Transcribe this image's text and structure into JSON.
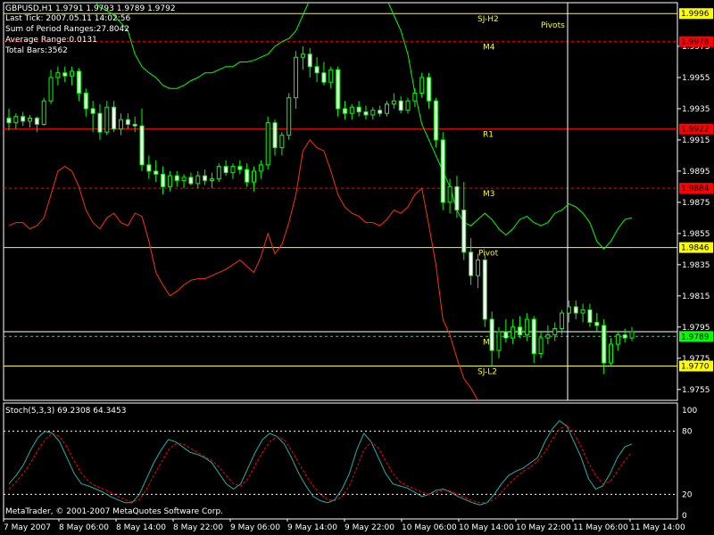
{
  "header": {
    "symbol_line": "GBPUSD,H1  1.9791 1.9793 1.9789 1.9792",
    "last_tick": "Last Tick: 2007.05.11 14:02:56",
    "sum_ranges": "Sum of Period Ranges:27.8042",
    "avg_range": "Average Range:0.0131",
    "total_bars": "Total Bars:3562"
  },
  "footer": {
    "copyright": "MetaTrader, © 2001-2007 MetaQuotes Software Corp.",
    "stoch_title": "Stoch(5,3,3) 69.2308 64.3453"
  },
  "colors": {
    "background": "#000000",
    "candle": "#00ff00",
    "upper_band": "#00ff00",
    "lower_band": "#ff3300",
    "pivot_line": "#ffff00",
    "resistance_line": "#ff0000",
    "stoch_main": "#20b2aa",
    "stoch_signal": "#ff0000",
    "axis": "#ffffff",
    "price_label_bg": "#000000"
  },
  "chart_data": [
    {
      "type": "candlestick",
      "title": "GBPUSD,H1",
      "ylim": [
        1.9748,
        2.0003
      ],
      "y_ticks": [
        1.9975,
        1.9955,
        1.9935,
        1.9915,
        1.9895,
        1.9875,
        1.9855,
        1.9835,
        1.9815,
        1.9795,
        1.9775,
        1.9755
      ],
      "x_ticks": [
        "7 May 2007",
        "8 May 06:00",
        "8 May 14:00",
        "8 May 22:00",
        "9 May 06:00",
        "9 May 14:00",
        "9 May 22:00",
        "10 May 06:00",
        "10 May 14:00",
        "10 May 22:00",
        "11 May 06:00",
        "11 May 14:00"
      ],
      "current_price": 1.9789,
      "levels": [
        {
          "name": "SJ-H2",
          "value": 1.9996,
          "color": "#ffff00"
        },
        {
          "name": "M4",
          "value": 1.9978,
          "color": "#ff0000",
          "dashed": true
        },
        {
          "name": "R1",
          "value": 1.9922,
          "color": "#ff0000"
        },
        {
          "name": "M3",
          "value": 1.9884,
          "color": "#ff0000",
          "dashed": true
        },
        {
          "name": "Pivot",
          "value": 1.9846,
          "color": "#ffff00"
        },
        {
          "name": "M2",
          "value": 1.9789,
          "color": "#00ff00",
          "dashed": true
        },
        {
          "name": "",
          "value": 1.9792,
          "color": "#ffffff"
        },
        {
          "name": "SJ-L2",
          "value": 1.977,
          "color": "#ffff00"
        }
      ],
      "price_labels": [
        {
          "text": "1.9996",
          "value": 1.9996,
          "bg": "#ffff00",
          "fg": "#000000"
        },
        {
          "text": "1.9978",
          "value": 1.9978,
          "bg": "#ff0000",
          "fg": "#000000"
        },
        {
          "text": "1.9922",
          "value": 1.9922,
          "bg": "#ff0000",
          "fg": "#000000"
        },
        {
          "text": "1.9884",
          "value": 1.9884,
          "bg": "#ff0000",
          "fg": "#000000"
        },
        {
          "text": "1.9846",
          "value": 1.9846,
          "bg": "#ffff00",
          "fg": "#000000"
        },
        {
          "text": "1.9789",
          "value": 1.9789,
          "bg": "#00ff00",
          "fg": "#000000"
        },
        {
          "text": "1.9770",
          "value": 1.977,
          "bg": "#ffff00",
          "fg": "#000000"
        }
      ],
      "vertical_marker_label": "Pivots",
      "candles": [
        {
          "o": 1.9929,
          "h": 1.9935,
          "l": 1.9921,
          "c": 1.9926
        },
        {
          "o": 1.9926,
          "h": 1.9932,
          "l": 1.9922,
          "c": 1.993
        },
        {
          "o": 1.993,
          "h": 1.9933,
          "l": 1.9924,
          "c": 1.9927
        },
        {
          "o": 1.9927,
          "h": 1.9931,
          "l": 1.9923,
          "c": 1.9929
        },
        {
          "o": 1.9929,
          "h": 1.993,
          "l": 1.992,
          "c": 1.9925
        },
        {
          "o": 1.9925,
          "h": 1.9942,
          "l": 1.9924,
          "c": 1.994
        },
        {
          "o": 1.994,
          "h": 1.996,
          "l": 1.9938,
          "c": 1.9955
        },
        {
          "o": 1.9955,
          "h": 1.9962,
          "l": 1.995,
          "c": 1.9958
        },
        {
          "o": 1.9958,
          "h": 1.9962,
          "l": 1.9952,
          "c": 1.9956
        },
        {
          "o": 1.9956,
          "h": 1.9962,
          "l": 1.995,
          "c": 1.9959
        },
        {
          "o": 1.9959,
          "h": 1.9961,
          "l": 1.994,
          "c": 1.9945
        },
        {
          "o": 1.9945,
          "h": 1.9948,
          "l": 1.993,
          "c": 1.9935
        },
        {
          "o": 1.9935,
          "h": 1.994,
          "l": 1.992,
          "c": 1.9932
        },
        {
          "o": 1.9932,
          "h": 1.9938,
          "l": 1.9915,
          "c": 1.992
        },
        {
          "o": 1.992,
          "h": 1.994,
          "l": 1.9918,
          "c": 1.9936
        },
        {
          "o": 1.9936,
          "h": 1.994,
          "l": 1.992,
          "c": 1.9922
        },
        {
          "o": 1.9922,
          "h": 1.9932,
          "l": 1.9918,
          "c": 1.9928
        },
        {
          "o": 1.9928,
          "h": 1.9932,
          "l": 1.9922,
          "c": 1.9925
        },
        {
          "o": 1.9925,
          "h": 1.993,
          "l": 1.992,
          "c": 1.9924
        },
        {
          "o": 1.9924,
          "h": 1.9935,
          "l": 1.9895,
          "c": 1.9899
        },
        {
          "o": 1.9899,
          "h": 1.9905,
          "l": 1.989,
          "c": 1.9895
        },
        {
          "o": 1.9895,
          "h": 1.9902,
          "l": 1.9888,
          "c": 1.9893
        },
        {
          "o": 1.9893,
          "h": 1.9898,
          "l": 1.988,
          "c": 1.9885
        },
        {
          "o": 1.9885,
          "h": 1.9895,
          "l": 1.9882,
          "c": 1.9892
        },
        {
          "o": 1.9892,
          "h": 1.9895,
          "l": 1.9885,
          "c": 1.9889
        },
        {
          "o": 1.9889,
          "h": 1.9893,
          "l": 1.9884,
          "c": 1.9891
        },
        {
          "o": 1.9891,
          "h": 1.9894,
          "l": 1.9886,
          "c": 1.9887
        },
        {
          "o": 1.9887,
          "h": 1.9895,
          "l": 1.9884,
          "c": 1.9892
        },
        {
          "o": 1.9892,
          "h": 1.9896,
          "l": 1.9886,
          "c": 1.9889
        },
        {
          "o": 1.9889,
          "h": 1.9894,
          "l": 1.9884,
          "c": 1.989
        },
        {
          "o": 1.989,
          "h": 1.99,
          "l": 1.9888,
          "c": 1.9898
        },
        {
          "o": 1.9898,
          "h": 1.9902,
          "l": 1.9892,
          "c": 1.9894
        },
        {
          "o": 1.9894,
          "h": 1.99,
          "l": 1.989,
          "c": 1.9898
        },
        {
          "o": 1.9898,
          "h": 1.9902,
          "l": 1.9893,
          "c": 1.9896
        },
        {
          "o": 1.9896,
          "h": 1.99,
          "l": 1.9885,
          "c": 1.9888
        },
        {
          "o": 1.9888,
          "h": 1.9898,
          "l": 1.9882,
          "c": 1.9895
        },
        {
          "o": 1.9895,
          "h": 1.9902,
          "l": 1.989,
          "c": 1.9899
        },
        {
          "o": 1.9899,
          "h": 1.993,
          "l": 1.9896,
          "c": 1.9926
        },
        {
          "o": 1.9926,
          "h": 1.9928,
          "l": 1.9905,
          "c": 1.991
        },
        {
          "o": 1.991,
          "h": 1.992,
          "l": 1.9905,
          "c": 1.9918
        },
        {
          "o": 1.9918,
          "h": 1.9945,
          "l": 1.9915,
          "c": 1.9942
        },
        {
          "o": 1.9942,
          "h": 1.9972,
          "l": 1.9935,
          "c": 1.9968
        },
        {
          "o": 1.9968,
          "h": 1.9975,
          "l": 1.996,
          "c": 1.997
        },
        {
          "o": 1.997,
          "h": 1.9974,
          "l": 1.9955,
          "c": 1.9962
        },
        {
          "o": 1.9962,
          "h": 1.9968,
          "l": 1.9952,
          "c": 1.9958
        },
        {
          "o": 1.9958,
          "h": 1.9965,
          "l": 1.995,
          "c": 1.9952
        },
        {
          "o": 1.9952,
          "h": 1.9962,
          "l": 1.9948,
          "c": 1.996
        },
        {
          "o": 1.996,
          "h": 1.9962,
          "l": 1.993,
          "c": 1.9935
        },
        {
          "o": 1.9935,
          "h": 1.994,
          "l": 1.9928,
          "c": 1.9932
        },
        {
          "o": 1.9932,
          "h": 1.9938,
          "l": 1.9928,
          "c": 1.9936
        },
        {
          "o": 1.9936,
          "h": 1.994,
          "l": 1.993,
          "c": 1.9933
        },
        {
          "o": 1.9933,
          "h": 1.9937,
          "l": 1.9928,
          "c": 1.9931
        },
        {
          "o": 1.9931,
          "h": 1.9936,
          "l": 1.9928,
          "c": 1.9934
        },
        {
          "o": 1.9934,
          "h": 1.9937,
          "l": 1.993,
          "c": 1.9932
        },
        {
          "o": 1.9932,
          "h": 1.994,
          "l": 1.993,
          "c": 1.9938
        },
        {
          "o": 1.9938,
          "h": 1.9945,
          "l": 1.9935,
          "c": 1.994
        },
        {
          "o": 1.994,
          "h": 1.9943,
          "l": 1.9932,
          "c": 1.9934
        },
        {
          "o": 1.9934,
          "h": 1.9942,
          "l": 1.9932,
          "c": 1.994
        },
        {
          "o": 1.994,
          "h": 1.9948,
          "l": 1.9936,
          "c": 1.9945
        },
        {
          "o": 1.9945,
          "h": 1.9958,
          "l": 1.9942,
          "c": 1.9955
        },
        {
          "o": 1.9955,
          "h": 1.9958,
          "l": 1.9935,
          "c": 1.994
        },
        {
          "o": 1.994,
          "h": 1.9942,
          "l": 1.991,
          "c": 1.9915
        },
        {
          "o": 1.9915,
          "h": 1.992,
          "l": 1.987,
          "c": 1.9875
        },
        {
          "o": 1.9875,
          "h": 1.989,
          "l": 1.9868,
          "c": 1.9885
        },
        {
          "o": 1.9885,
          "h": 1.9892,
          "l": 1.9865,
          "c": 1.987
        },
        {
          "o": 1.987,
          "h": 1.9888,
          "l": 1.9838,
          "c": 1.9843
        },
        {
          "o": 1.9843,
          "h": 1.9852,
          "l": 1.9822,
          "c": 1.9828
        },
        {
          "o": 1.9828,
          "h": 1.9842,
          "l": 1.982,
          "c": 1.9838
        },
        {
          "o": 1.9838,
          "h": 1.9842,
          "l": 1.9795,
          "c": 1.98
        },
        {
          "o": 1.98,
          "h": 1.9805,
          "l": 1.977,
          "c": 1.978
        },
        {
          "o": 1.978,
          "h": 1.9795,
          "l": 1.9775,
          "c": 1.9792
        },
        {
          "o": 1.9792,
          "h": 1.98,
          "l": 1.9785,
          "c": 1.9788
        },
        {
          "o": 1.9788,
          "h": 1.98,
          "l": 1.9784,
          "c": 1.9795
        },
        {
          "o": 1.9795,
          "h": 1.9802,
          "l": 1.9788,
          "c": 1.979
        },
        {
          "o": 1.979,
          "h": 1.9804,
          "l": 1.9786,
          "c": 1.98
        },
        {
          "o": 1.98,
          "h": 1.9802,
          "l": 1.9772,
          "c": 1.9778
        },
        {
          "o": 1.9778,
          "h": 1.9792,
          "l": 1.9775,
          "c": 1.9788
        },
        {
          "o": 1.9788,
          "h": 1.9796,
          "l": 1.9784,
          "c": 1.979
        },
        {
          "o": 1.979,
          "h": 1.9798,
          "l": 1.9786,
          "c": 1.9794
        },
        {
          "o": 1.9794,
          "h": 1.9806,
          "l": 1.979,
          "c": 1.9804
        },
        {
          "o": 1.9804,
          "h": 1.9812,
          "l": 1.9798,
          "c": 1.9808
        },
        {
          "o": 1.9808,
          "h": 1.9812,
          "l": 1.98,
          "c": 1.9804
        },
        {
          "o": 1.9804,
          "h": 1.981,
          "l": 1.9798,
          "c": 1.9806
        },
        {
          "o": 1.9806,
          "h": 1.981,
          "l": 1.9795,
          "c": 1.9798
        },
        {
          "o": 1.9798,
          "h": 1.9804,
          "l": 1.9792,
          "c": 1.9796
        },
        {
          "o": 1.9796,
          "h": 1.98,
          "l": 1.9765,
          "c": 1.9772
        },
        {
          "o": 1.9772,
          "h": 1.9788,
          "l": 1.977,
          "c": 1.9784
        },
        {
          "o": 1.9784,
          "h": 1.9792,
          "l": 1.978,
          "c": 1.979
        },
        {
          "o": 1.979,
          "h": 1.9794,
          "l": 1.9785,
          "c": 1.9788
        },
        {
          "o": 1.9788,
          "h": 1.9795,
          "l": 1.9786,
          "c": 1.9792
        }
      ],
      "upper_band": [
        2.0015,
        2.0015,
        2.0015,
        2.0015,
        2.0015,
        2.0015,
        2.0015,
        2.0015,
        2.0015,
        2.0015,
        2.0012,
        2.0008,
        2.0005,
        2.0,
        1.9998,
        1.9995,
        1.999,
        1.9985,
        1.997,
        1.9962,
        1.9958,
        1.9955,
        1.995,
        1.9948,
        1.9948,
        1.995,
        1.9953,
        1.9955,
        1.9958,
        1.9958,
        1.996,
        1.9962,
        1.9962,
        1.9965,
        1.9965,
        1.9966,
        1.9968,
        1.997,
        1.9975,
        1.9978,
        1.998,
        1.9985,
        1.9995,
        2.0005,
        2.0012,
        2.0015,
        2.0015,
        2.0015,
        2.0015,
        2.0015,
        2.0015,
        2.0015,
        2.0015,
        2.0015,
        2.0005,
        1.9995,
        1.9985,
        1.997,
        1.9945,
        1.9925,
        1.9915,
        1.9905,
        1.9895,
        1.9885,
        1.987,
        1.9862,
        1.986,
        1.9864,
        1.9868,
        1.9864,
        1.9858,
        1.9854,
        1.9858,
        1.9864,
        1.9866,
        1.9862,
        1.986,
        1.9862,
        1.9868,
        1.987,
        1.9874,
        1.9872,
        1.9868,
        1.9862,
        1.985,
        1.9845,
        1.985,
        1.9858,
        1.9864,
        1.9865
      ],
      "lower_band": [
        1.986,
        1.9862,
        1.9862,
        1.9858,
        1.986,
        1.9865,
        1.988,
        1.9895,
        1.9898,
        1.9895,
        1.9885,
        1.987,
        1.9862,
        1.9858,
        1.9865,
        1.9868,
        1.9862,
        1.986,
        1.9868,
        1.9866,
        1.985,
        1.983,
        1.9822,
        1.9815,
        1.9818,
        1.9822,
        1.9825,
        1.9826,
        1.9826,
        1.9828,
        1.983,
        1.9832,
        1.9835,
        1.9838,
        1.9834,
        1.983,
        1.984,
        1.9855,
        1.9842,
        1.9848,
        1.9862,
        1.988,
        1.9908,
        1.9915,
        1.991,
        1.9908,
        1.9895,
        1.988,
        1.9872,
        1.9868,
        1.9866,
        1.9862,
        1.9862,
        1.986,
        1.9864,
        1.987,
        1.9868,
        1.9872,
        1.988,
        1.9884,
        1.986,
        1.9835,
        1.98,
        1.979,
        1.9775,
        1.9762,
        1.9756,
        1.9748,
        1.974,
        1.9735,
        1.973,
        1.9725,
        1.9722,
        1.972,
        1.972,
        1.972,
        1.972,
        1.972,
        1.972,
        1.972,
        1.972,
        1.972,
        1.972,
        1.972,
        1.972,
        1.972,
        1.972,
        1.972,
        1.972,
        1.972
      ]
    },
    {
      "type": "line",
      "title": "Stoch(5,3,3)",
      "ylim": [
        0,
        100
      ],
      "y_ticks": [
        100,
        80,
        20,
        0
      ],
      "levels": [
        80,
        20
      ],
      "series": [
        {
          "name": "Main",
          "color": "#20b2aa",
          "values": [
            30,
            38,
            48,
            62,
            74,
            80,
            78,
            70,
            55,
            40,
            30,
            28,
            25,
            22,
            18,
            15,
            12,
            12,
            20,
            35,
            50,
            62,
            72,
            70,
            65,
            60,
            58,
            55,
            50,
            40,
            30,
            25,
            30,
            45,
            60,
            72,
            78,
            75,
            68,
            55,
            40,
            28,
            18,
            14,
            12,
            15,
            25,
            40,
            62,
            78,
            70,
            55,
            40,
            30,
            28,
            26,
            22,
            18,
            20,
            24,
            25,
            22,
            18,
            15,
            12,
            10,
            12,
            20,
            30,
            38,
            42,
            45,
            50,
            55,
            70,
            82,
            90,
            85,
            70,
            55,
            35,
            25,
            28,
            40,
            55,
            65,
            68
          ]
        },
        {
          "name": "Signal",
          "color": "#ff0000",
          "values": [
            25,
            32,
            40,
            50,
            62,
            72,
            78,
            75,
            65,
            52,
            40,
            32,
            28,
            25,
            22,
            18,
            15,
            13,
            15,
            25,
            38,
            50,
            62,
            68,
            68,
            64,
            60,
            56,
            52,
            46,
            38,
            30,
            28,
            35,
            48,
            60,
            70,
            75,
            72,
            62,
            50,
            38,
            28,
            20,
            15,
            14,
            18,
            28,
            45,
            62,
            70,
            64,
            52,
            40,
            32,
            28,
            25,
            22,
            20,
            22,
            24,
            23,
            20,
            17,
            14,
            12,
            12,
            15,
            22,
            30,
            36,
            42,
            46,
            52,
            60,
            72,
            82,
            86,
            78,
            65,
            50,
            38,
            30,
            32,
            42,
            52,
            60
          ]
        }
      ]
    }
  ]
}
